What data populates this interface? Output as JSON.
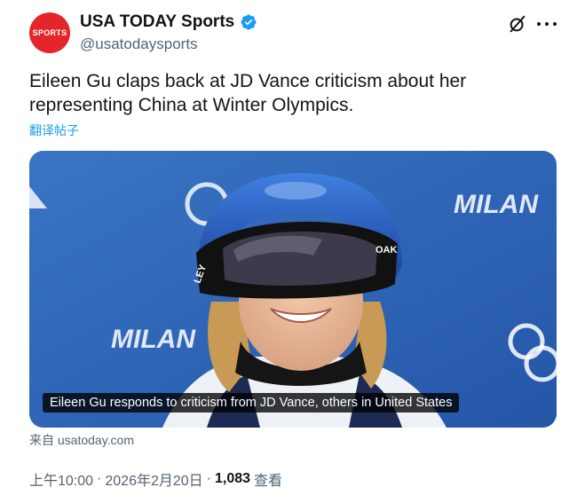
{
  "author": {
    "avatar_text": "SPORTS",
    "display_name": "USA TODAY Sports",
    "handle": "@usatodaysports",
    "verified": true
  },
  "post": {
    "text": "Eileen Gu claps back at JD Vance criticism about her representing China at Winter Olympics.",
    "translate_label": "翻译帖子"
  },
  "media": {
    "caption": "Eileen Gu responds to criticism from JD Vance, others in United States",
    "background_text_1": "MILAN",
    "background_text_2": "MILAN",
    "goggle_text_left": "LEY",
    "goggle_text_right": "OAK"
  },
  "link_source": "来自 usatoday.com",
  "meta": {
    "time": "上午10:00",
    "separator_1": "·",
    "date": "2026年2月20日",
    "separator_2": "·",
    "views_count": "1,083",
    "views_label": "查看"
  },
  "colors": {
    "avatar": "#e4262b",
    "verified": "#1d9bf0",
    "link": "#1d9bf0",
    "secondary_text": "#536471"
  },
  "icons": {
    "verified": "verified-badge-icon",
    "grok": "grok-icon",
    "more": "more-icon"
  }
}
